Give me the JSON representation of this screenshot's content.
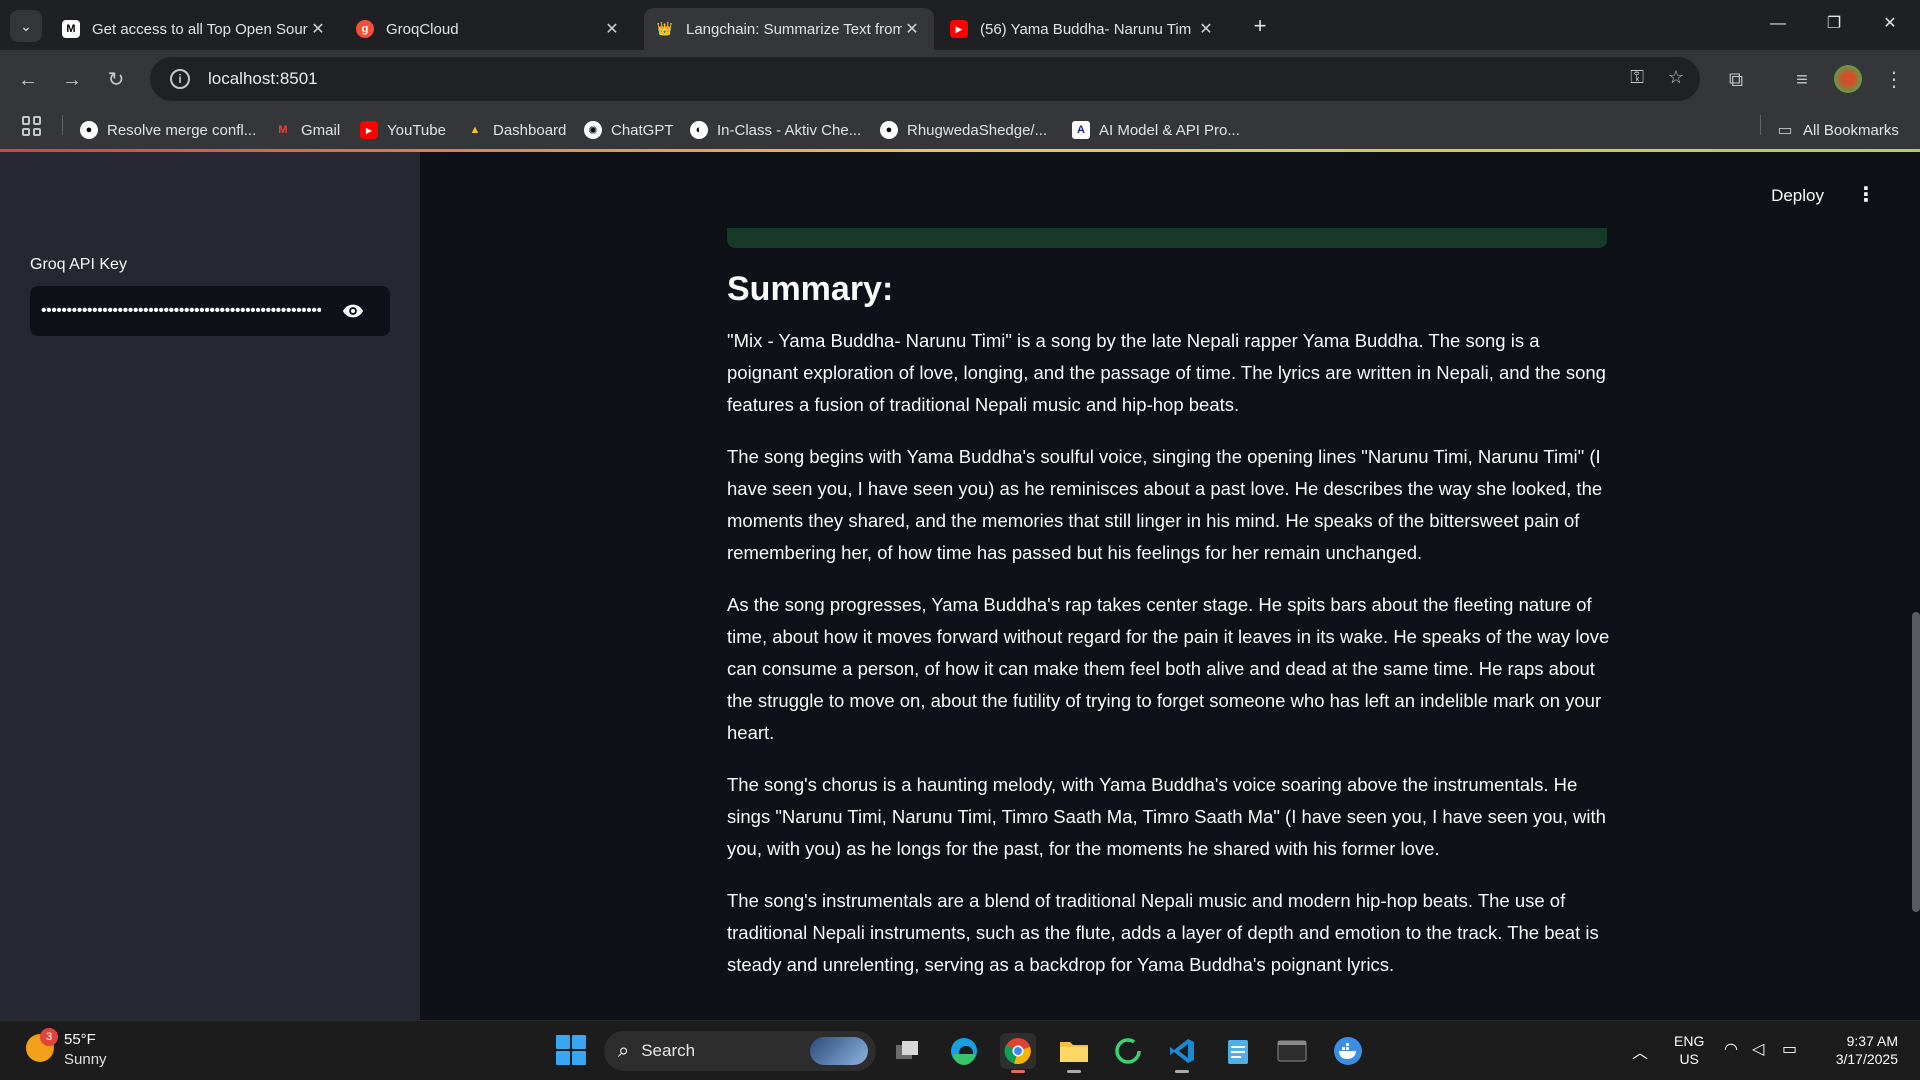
{
  "browser": {
    "tabs": [
      {
        "title": "Get access to all Top Open Sour",
        "fav": "M"
      },
      {
        "title": "GroqCloud",
        "fav": "g"
      },
      {
        "title": "Langchain: Summarize Text from",
        "fav": "👑"
      },
      {
        "title": "(56) Yama Buddha- Narunu Tim",
        "fav": "▶"
      }
    ],
    "url": "localhost:8501",
    "bookmarks": [
      {
        "label": "Resolve merge confl..."
      },
      {
        "label": "Gmail"
      },
      {
        "label": "YouTube"
      },
      {
        "label": "Dashboard"
      },
      {
        "label": "ChatGPT"
      },
      {
        "label": "In-Class - Aktiv Che..."
      },
      {
        "label": "RhugwedaShedge/..."
      },
      {
        "label": "AI Model & API Pro..."
      }
    ],
    "all_bookmarks": "All Bookmarks"
  },
  "sidebar": {
    "label": "Groq API Key",
    "api_key_value": "••••••••••••••••••••••••••••••••••••••••••••••••••••••••"
  },
  "header": {
    "deploy": "Deploy",
    "menu": "⋮"
  },
  "main": {
    "heading": "Summary:",
    "paragraphs": [
      "\"Mix - Yama Buddha- Narunu Timi\" is a song by the late Nepali rapper Yama Buddha. The song is a poignant exploration of love, longing, and the passage of time. The lyrics are written in Nepali, and the song features a fusion of traditional Nepali music and hip-hop beats.",
      "The song begins with Yama Buddha's soulful voice, singing the opening lines \"Narunu Timi, Narunu Timi\" (I have seen you, I have seen you) as he reminisces about a past love. He describes the way she looked, the moments they shared, and the memories that still linger in his mind. He speaks of the bittersweet pain of remembering her, of how time has passed but his feelings for her remain unchanged.",
      "As the song progresses, Yama Buddha's rap takes center stage. He spits bars about the fleeting nature of time, about how it moves forward without regard for the pain it leaves in its wake. He speaks of the way love can consume a person, of how it can make them feel both alive and dead at the same time. He raps about the struggle to move on, about the futility of trying to forget someone who has left an indelible mark on your heart.",
      "The song's chorus is a haunting melody, with Yama Buddha's voice soaring above the instrumentals. He sings \"Narunu Timi, Narunu Timi, Timro Saath Ma, Timro Saath Ma\" (I have seen you, I have seen you, with you, with you) as he longs for the past, for the moments he shared with his former love.",
      "The song's instrumentals are a blend of traditional Nepali music and modern hip-hop beats. The use of traditional Nepali instruments, such as the flute, adds a layer of depth and emotion to the track. The beat is steady and unrelenting, serving as a backdrop for Yama Buddha's poignant lyrics."
    ]
  },
  "taskbar": {
    "weather_badge": "3",
    "temperature": "55°F",
    "weather": "Sunny",
    "search": "Search",
    "lang": "ENG",
    "region": "US",
    "time": "9:37 AM",
    "date": "3/17/2025"
  }
}
